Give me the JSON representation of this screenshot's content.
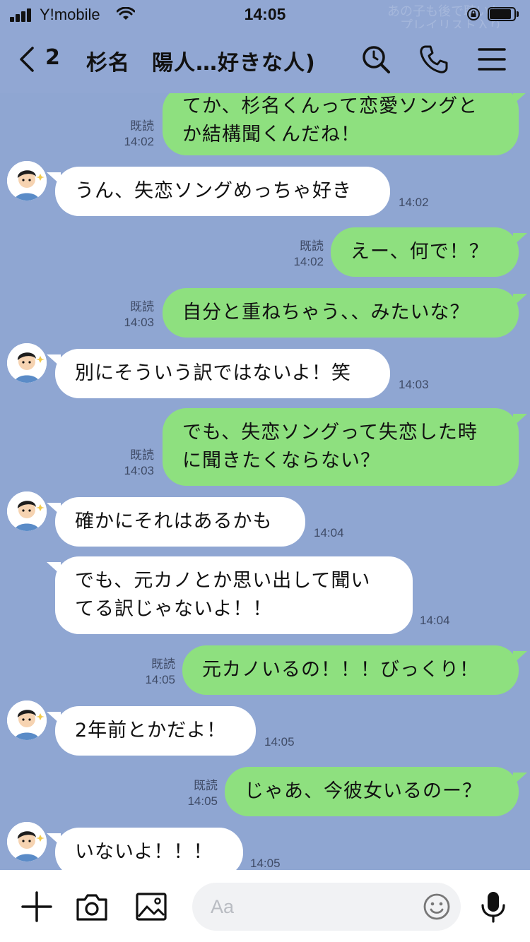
{
  "status": {
    "carrier": "Y!mobile",
    "time": "14:05",
    "banner_line1": "あの子も後で聴いた",
    "banner_line2": "プレイリスト入り"
  },
  "header": {
    "back_count": "2",
    "title": "杉名　陽人…好きな人)"
  },
  "messages": [
    {
      "side": "out",
      "lines": [
        "てか、杉名くんって恋愛ソングと",
        "か結構聞くんだね！"
      ],
      "read": "既読",
      "time": "14:02"
    },
    {
      "side": "in",
      "lines": [
        "うん、失恋ソングめっちゃ好き"
      ],
      "time": "14:02"
    },
    {
      "side": "out",
      "lines": [
        "えー、何で！？"
      ],
      "read": "既読",
      "time": "14:02"
    },
    {
      "side": "out",
      "lines": [
        "自分と重ねちゃう、、みたいな？"
      ],
      "read": "既読",
      "time": "14:03"
    },
    {
      "side": "in",
      "lines": [
        "別にそういう訳ではないよ！笑"
      ],
      "time": "14:03"
    },
    {
      "side": "out",
      "lines": [
        "でも、失恋ソングって失恋した時",
        "に聞きたくならない？"
      ],
      "read": "既読",
      "time": "14:03"
    },
    {
      "side": "in",
      "lines": [
        "確かにそれはあるかも"
      ],
      "time": "14:04"
    },
    {
      "side": "in",
      "lines": [
        "でも、元カノとか思い出して聞い",
        "てる訳じゃないよ！！"
      ],
      "time": "14:04"
    },
    {
      "side": "out",
      "lines": [
        "元カノいるの！！！びっくり！"
      ],
      "read": "既読",
      "time": "14:05"
    },
    {
      "side": "in",
      "lines": [
        "2年前とかだよ！"
      ],
      "time": "14:05"
    },
    {
      "side": "out",
      "lines": [
        "じゃあ、今彼女いるのー？"
      ],
      "read": "既読",
      "time": "14:05"
    },
    {
      "side": "in",
      "lines": [
        "いないよ！！！"
      ],
      "time": "14:05"
    }
  ],
  "input": {
    "placeholder": "Aa"
  },
  "icons": {
    "back": "chevron-left-icon",
    "search": "search-icon",
    "call": "phone-icon",
    "menu": "menu-icon",
    "plus": "plus-icon",
    "camera": "camera-icon",
    "image": "image-icon",
    "emoji": "emoji-icon",
    "mic": "microphone-icon"
  },
  "colors": {
    "background": "#8fa6d2",
    "outgoing_bubble": "#8ee07f",
    "incoming_bubble": "#ffffff"
  }
}
